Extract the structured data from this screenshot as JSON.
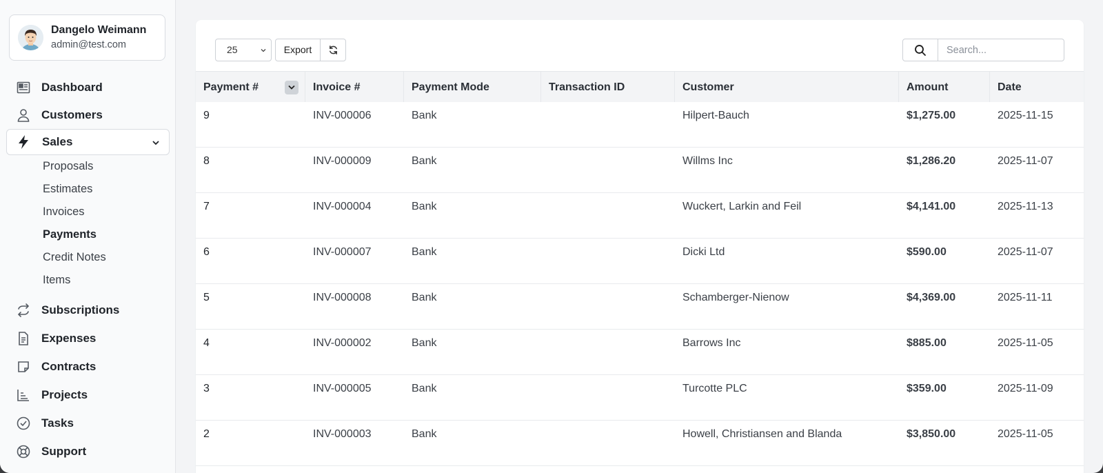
{
  "user": {
    "name": "Dangelo Weimann",
    "email": "admin@test.com"
  },
  "nav": {
    "dashboard": "Dashboard",
    "customers": "Customers",
    "sales": "Sales",
    "sales_sub": [
      "Proposals",
      "Estimates",
      "Invoices",
      "Payments",
      "Credit Notes",
      "Items"
    ],
    "subscriptions": "Subscriptions",
    "expenses": "Expenses",
    "contracts": "Contracts",
    "projects": "Projects",
    "tasks": "Tasks",
    "support": "Support"
  },
  "toolbar": {
    "page_size": "25",
    "export_label": "Export",
    "search_placeholder": "Search..."
  },
  "table": {
    "columns": [
      "Payment #",
      "Invoice #",
      "Payment Mode",
      "Transaction ID",
      "Customer",
      "Amount",
      "Date"
    ],
    "rows": [
      {
        "payment": "9",
        "invoice": "INV-000006",
        "mode": "Bank",
        "txn": "",
        "customer": "Hilpert-Bauch",
        "amount": "$1,275.00",
        "date": "2025-11-15"
      },
      {
        "payment": "8",
        "invoice": "INV-000009",
        "mode": "Bank",
        "txn": "",
        "customer": "Willms Inc",
        "amount": "$1,286.20",
        "date": "2025-11-07"
      },
      {
        "payment": "7",
        "invoice": "INV-000004",
        "mode": "Bank",
        "txn": "",
        "customer": "Wuckert, Larkin and Feil",
        "amount": "$4,141.00",
        "date": "2025-11-13"
      },
      {
        "payment": "6",
        "invoice": "INV-000007",
        "mode": "Bank",
        "txn": "",
        "customer": "Dicki Ltd",
        "amount": "$590.00",
        "date": "2025-11-07"
      },
      {
        "payment": "5",
        "invoice": "INV-000008",
        "mode": "Bank",
        "txn": "",
        "customer": "Schamberger-Nienow",
        "amount": "$4,369.00",
        "date": "2025-11-11"
      },
      {
        "payment": "4",
        "invoice": "INV-000002",
        "mode": "Bank",
        "txn": "",
        "customer": "Barrows Inc",
        "amount": "$885.00",
        "date": "2025-11-05"
      },
      {
        "payment": "3",
        "invoice": "INV-000005",
        "mode": "Bank",
        "txn": "",
        "customer": "Turcotte PLC",
        "amount": "$359.00",
        "date": "2025-11-09"
      },
      {
        "payment": "2",
        "invoice": "INV-000003",
        "mode": "Bank",
        "txn": "",
        "customer": "Howell, Christiansen and Blanda",
        "amount": "$3,850.00",
        "date": "2025-11-05"
      }
    ]
  }
}
